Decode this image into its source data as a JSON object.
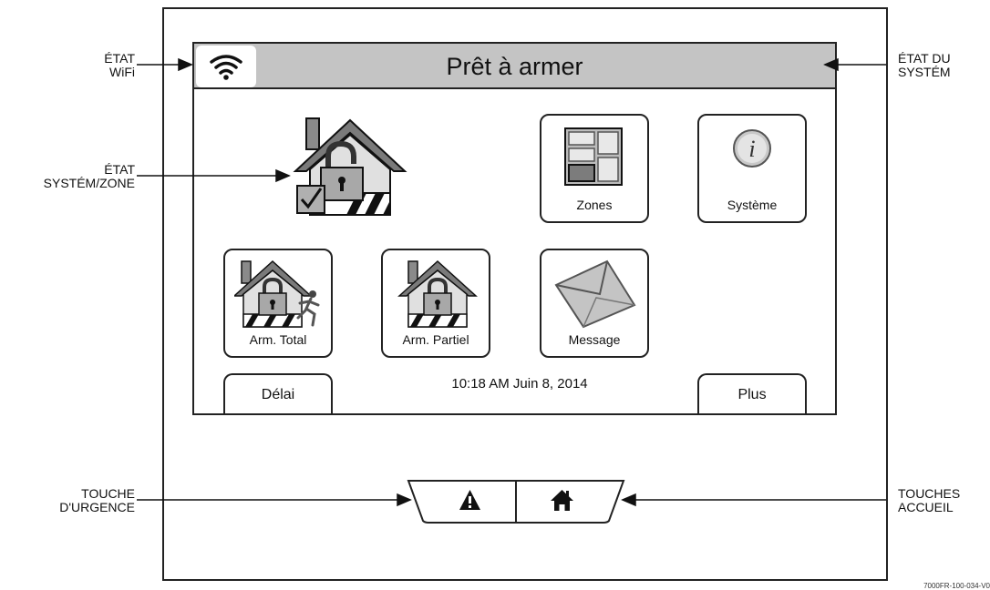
{
  "header": {
    "status_title": "Prêt à armer"
  },
  "icons": {
    "wifi": "wifi-icon",
    "system_zone": "house-lock-icon",
    "zones": "zones-icon",
    "system": "info-icon",
    "arm_away": "house-lock-runner-icon",
    "arm_stay": "house-lock-icon",
    "message": "envelope-icon",
    "emergency": "warning-icon",
    "home": "home-icon"
  },
  "tiles": {
    "zones": "Zones",
    "system": "Système",
    "arm_total": "Arm. Total",
    "arm_partiel": "Arm. Partiel",
    "message": "Message"
  },
  "bottom": {
    "delay": "Délai",
    "datetime": "10:18 AM Juin 8, 2014",
    "more": "Plus"
  },
  "callouts": {
    "wifi_status": [
      "ÉTAT",
      "WiFi"
    ],
    "system_zone_status": [
      "ÉTAT",
      "SYSTÉM/ZONE"
    ],
    "emergency_key": [
      "TOUCHE",
      "D'URGENCE"
    ],
    "system_status": [
      "ÉTAT DU",
      "SYSTÉM"
    ],
    "home_keys": [
      "TOUCHES",
      "ACCUEIL"
    ]
  },
  "footnote": "7000FR-100-034-V0"
}
